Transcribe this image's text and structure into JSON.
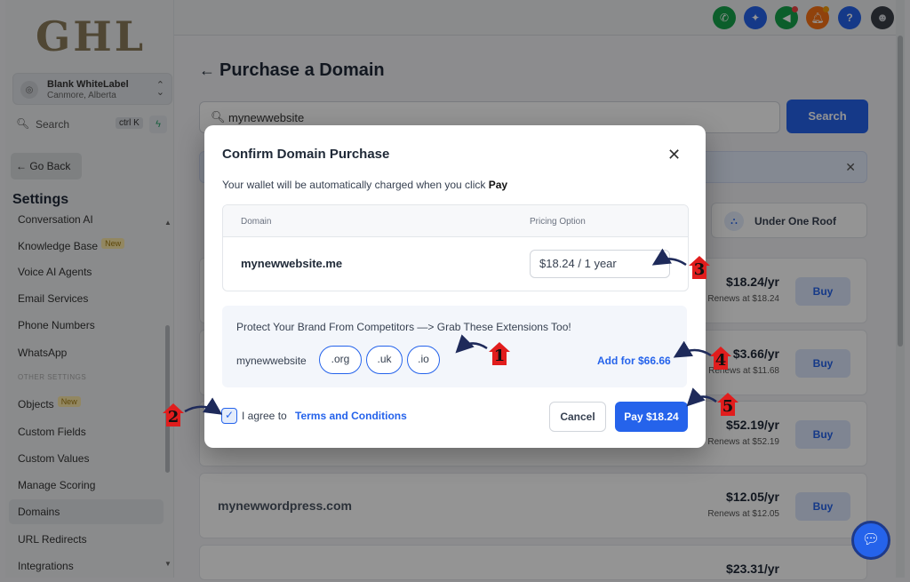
{
  "sidebar": {
    "logo": "GHL",
    "account_name": "Blank WhiteLabel",
    "account_location": "Canmore, Alberta",
    "search_placeholder": "Search",
    "search_shortcut": "ctrl K",
    "go_back": "← Go Back",
    "settings_title": "Settings",
    "items": [
      {
        "label": "Conversation AI"
      },
      {
        "label": "Knowledge Base",
        "badge": "New"
      },
      {
        "label": "Voice AI Agents"
      },
      {
        "label": "Email Services"
      },
      {
        "label": "Phone Numbers"
      },
      {
        "label": "WhatsApp"
      },
      {
        "label": "OTHER SETTINGS"
      },
      {
        "label": "Objects",
        "badge": "New"
      },
      {
        "label": "Custom Fields"
      },
      {
        "label": "Custom Values"
      },
      {
        "label": "Manage Scoring"
      },
      {
        "label": "Domains"
      },
      {
        "label": "URL Redirects"
      },
      {
        "label": "Integrations"
      }
    ]
  },
  "topbar": {
    "icons": [
      "phone-icon",
      "apps-icon",
      "megaphone-icon",
      "bell-icon",
      "help-icon",
      "user-avatar"
    ],
    "help_label": "?"
  },
  "main": {
    "title": "Purchase a Domain",
    "search_value": "mynewwebsite",
    "search_button": "Search",
    "under_one_roof": "Under One Roof",
    "results": [
      {
        "domain": "",
        "price": "$18.24/yr",
        "renews": "Renews at $18.24",
        "buy": "Buy"
      },
      {
        "domain": "",
        "price": "$3.66/yr",
        "renews": "Renews at $11.68",
        "buy": "Buy"
      },
      {
        "domain": "",
        "price": "$52.19/yr",
        "renews": "Renews at $52.19",
        "buy": "Buy"
      },
      {
        "domain": "mynewwordpress.com",
        "price": "$12.05/yr",
        "renews": "Renews at $12.05",
        "buy": "Buy"
      },
      {
        "domain": "",
        "price": "$23.31/yr",
        "renews": "",
        "buy": ""
      }
    ]
  },
  "modal": {
    "title": "Confirm Domain Purchase",
    "subtitle": "Your wallet will be automatically charged when you click",
    "subtitle_bold": "Pay",
    "col_domain": "Domain",
    "col_pricing": "Pricing Option",
    "domain": "mynewwebsite.me",
    "pricing_option": "$18.24 / 1 year",
    "upsell_title": "Protect Your Brand From Competitors —> Grab These Extensions Too!",
    "upsell_name": "mynewwebsite",
    "extensions": [
      ".org",
      ".uk",
      ".io"
    ],
    "add_for": "Add for $66.66",
    "agree_text": "I agree to",
    "terms_link": "Terms and Conditions",
    "agree_checked": true,
    "cancel": "Cancel",
    "pay": "Pay $18.24"
  },
  "annotations": [
    "1",
    "2",
    "3",
    "4",
    "5"
  ],
  "colors": {
    "accent": "#2563eb",
    "marker": "#e11d1d"
  }
}
